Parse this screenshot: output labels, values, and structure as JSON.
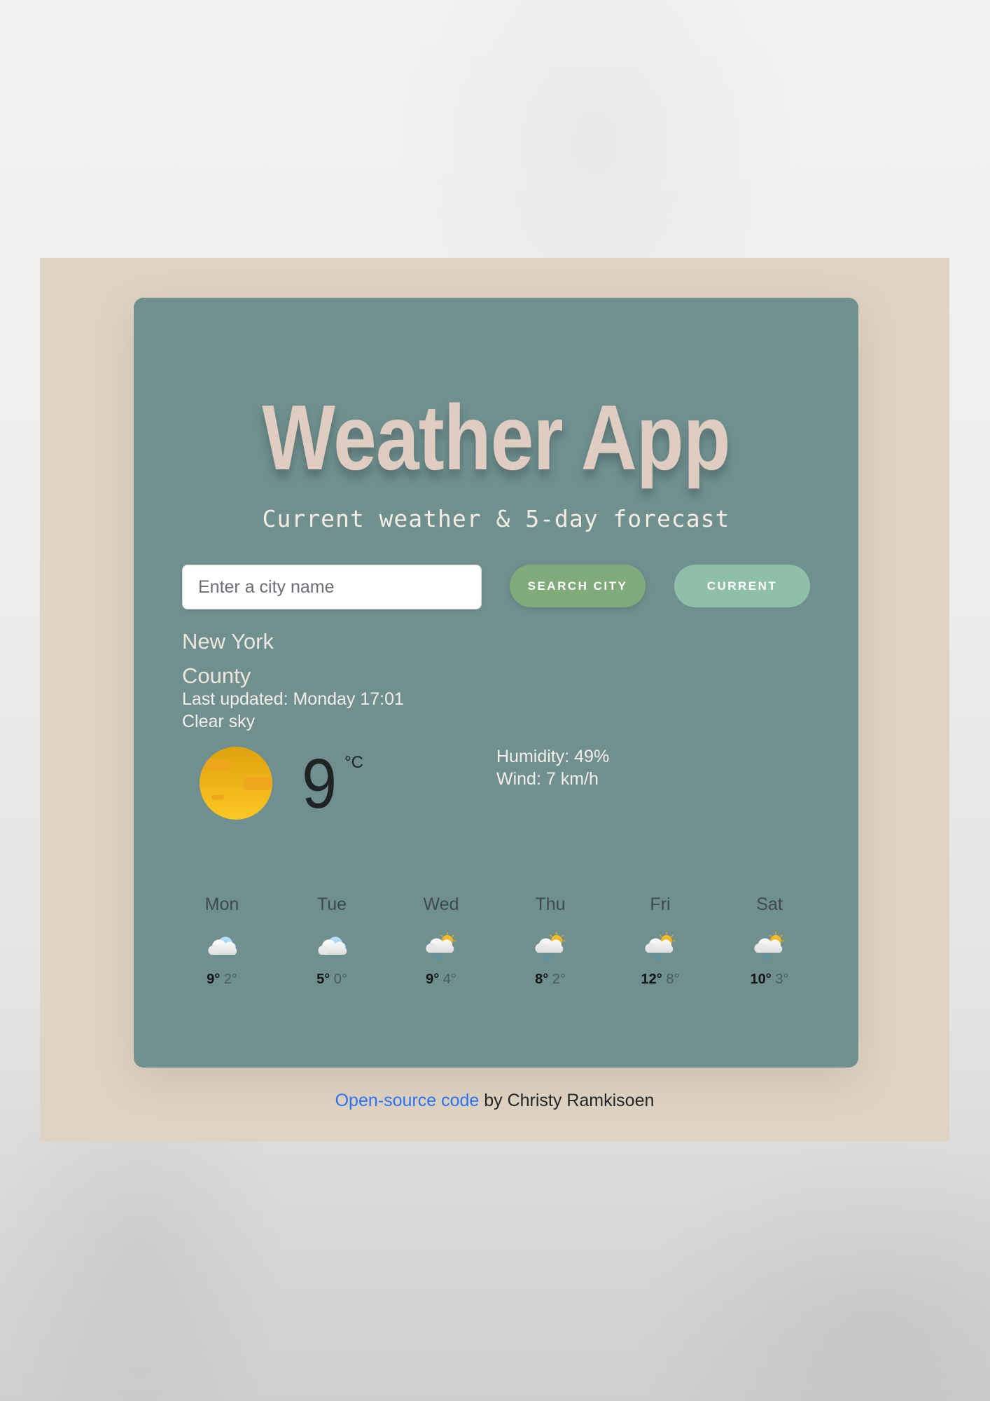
{
  "app": {
    "title": "Weather App",
    "subtitle": "Current weather & 5-day forecast"
  },
  "search": {
    "placeholder": "Enter a city name",
    "value": "",
    "search_button_label": "SEARCH CITY",
    "current_button_label": "CURRENT"
  },
  "current": {
    "city": "New York County",
    "last_updated": "Last updated: Monday 17:01",
    "description": "Clear sky",
    "icon": "clear-sky-sun-icon",
    "temperature": "9",
    "unit": "°C",
    "humidity": "Humidity: 49%",
    "wind": "Wind: 7 km/h"
  },
  "forecast": [
    {
      "day": "Mon",
      "icon": "cloudy-icon",
      "max": "9°",
      "min": "2°"
    },
    {
      "day": "Tue",
      "icon": "cloudy-icon",
      "max": "5°",
      "min": "0°"
    },
    {
      "day": "Wed",
      "icon": "partly-sunny-rain-icon",
      "max": "9°",
      "min": "4°"
    },
    {
      "day": "Thu",
      "icon": "partly-sunny-rain-icon",
      "max": "8°",
      "min": "2°"
    },
    {
      "day": "Fri",
      "icon": "partly-sunny-rain-icon",
      "max": "12°",
      "min": "8°"
    },
    {
      "day": "Sat",
      "icon": "partly-sunny-rain-icon",
      "max": "10°",
      "min": "3°"
    }
  ],
  "footer": {
    "link_text": "Open-source code",
    "credit_text": " by Christy Ramkisoen"
  },
  "colors": {
    "outer_background": "#dfd3c3",
    "card_background": "#708f8f",
    "title_color": "#e0cdc2",
    "search_button": "#7fab7a",
    "current_button": "#8fbfa9",
    "link": "#2a72f0"
  }
}
